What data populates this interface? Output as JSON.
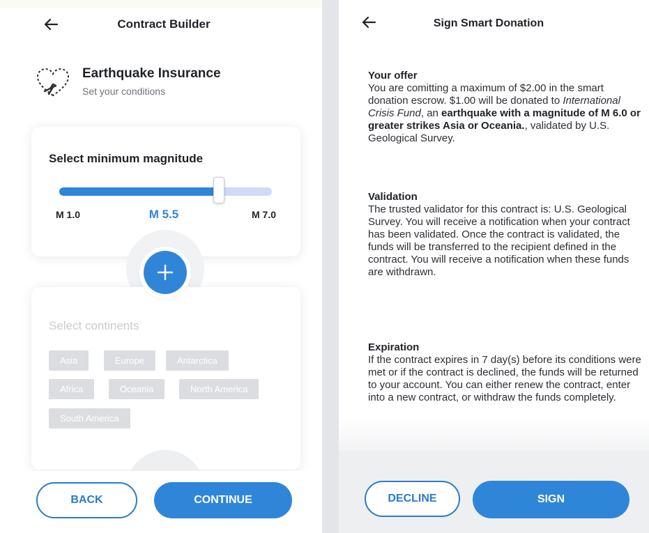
{
  "left": {
    "header": {
      "title": "Contract Builder"
    },
    "contract": {
      "name": "Earthquake Insurance",
      "subtitle": "Set your conditions"
    },
    "magnitude": {
      "label": "Select minimum magnitude",
      "min_label": "M 1.0",
      "max_label": "M 7.0",
      "current_label": "M 5.5",
      "min": 1.0,
      "max": 7.0,
      "value": 5.5
    },
    "add_icon": "plus-icon",
    "continents": {
      "label": "Select continents",
      "options": [
        "Asia",
        "Europe",
        "Antarctica",
        "Africa",
        "Oceania",
        "North America",
        "South America"
      ]
    },
    "buttons": {
      "back": "BACK",
      "continue": "CONTINUE"
    }
  },
  "right": {
    "header": {
      "title": "Sign Smart Donation"
    },
    "offer": {
      "heading": "Your offer",
      "t1": "You are comitting a maximum of $2.00 in the smart donation escrow. $1.00 will be donated to ",
      "recipient": "International Crisis Fund",
      "t2": ", an ",
      "condition": "earthquake with a magnitude of M 6.0 or greater strikes Asia or Oceania.",
      "t3": ", validated by U.S. Geological Survey."
    },
    "validation": {
      "heading": "Validation",
      "text": "The trusted validator for this contract is: U.S. Geological Survey. You will receive a notification when your contract has been validated. Once the contract is validated, the funds will be transferred to the recipient defined in the contract. You will receive a notification when these funds are withdrawn."
    },
    "expiration": {
      "heading": "Expiration",
      "text": "If the contract expires in 7 day(s) before its conditions were met or if the contract is declined, the funds will be returned to your account. You can either renew the contract, enter into a new contract, or withdraw the funds completely."
    },
    "buttons": {
      "decline": "DECLINE",
      "sign": "SIGN"
    }
  },
  "colors": {
    "accent": "#2f86d8",
    "track": "#cfdaf7",
    "chip": "#dcdde0",
    "placeholder": "#c9cbcf",
    "panel": "#eeeff1"
  },
  "icons": {
    "back": "arrow-left-icon",
    "contract": "heart-ribbon-icon"
  }
}
